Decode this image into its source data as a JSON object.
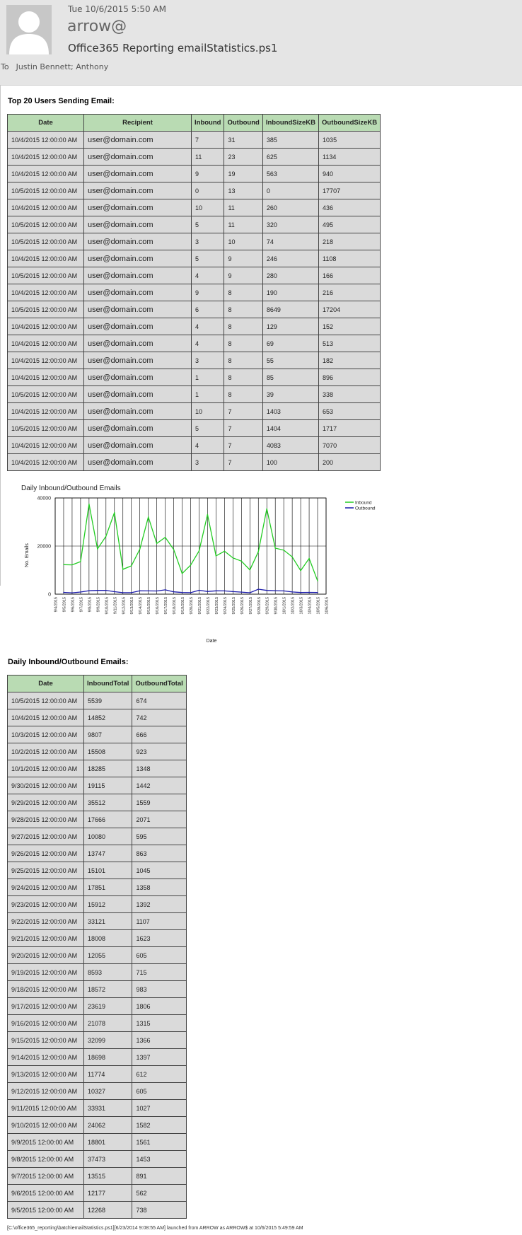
{
  "header": {
    "date": "Tue 10/6/2015 5:50 AM",
    "from": "arrow@",
    "subject": "Office365 Reporting emailStatistics.ps1",
    "to_label": "To",
    "recipients": "Justin Bennett; Anthony"
  },
  "top_users": {
    "title": "Top 20 Users Sending Email:",
    "columns": [
      "Date",
      "Recipient",
      "Inbound",
      "Outbound",
      "InboundSizeKB",
      "OutboundSizeKB"
    ],
    "rows": [
      [
        "10/4/2015 12:00:00 AM",
        "user@domain.com",
        "7",
        "31",
        "385",
        "1035"
      ],
      [
        "10/4/2015 12:00:00 AM",
        "user@domain.com",
        "11",
        "23",
        "625",
        "1134"
      ],
      [
        "10/4/2015 12:00:00 AM",
        "user@domain.com",
        "9",
        "19",
        "563",
        "940"
      ],
      [
        "10/5/2015 12:00:00 AM",
        "user@domain.com",
        "0",
        "13",
        "0",
        "17707"
      ],
      [
        "10/4/2015 12:00:00 AM",
        "user@domain.com",
        "10",
        "11",
        "260",
        "436"
      ],
      [
        "10/5/2015 12:00:00 AM",
        "user@domain.com",
        "5",
        "11",
        "320",
        "495"
      ],
      [
        "10/5/2015 12:00:00 AM",
        "user@domain.com",
        "3",
        "10",
        "74",
        "218"
      ],
      [
        "10/4/2015 12:00:00 AM",
        "user@domain.com",
        "5",
        "9",
        "246",
        "1108"
      ],
      [
        "10/5/2015 12:00:00 AM",
        "user@domain.com",
        "4",
        "9",
        "280",
        "166"
      ],
      [
        "10/4/2015 12:00:00 AM",
        "user@domain.com",
        "9",
        "8",
        "190",
        "216"
      ],
      [
        "10/5/2015 12:00:00 AM",
        "user@domain.com",
        "6",
        "8",
        "8649",
        "17204"
      ],
      [
        "10/4/2015 12:00:00 AM",
        "user@domain.com",
        "4",
        "8",
        "129",
        "152"
      ],
      [
        "10/4/2015 12:00:00 AM",
        "user@domain.com",
        "4",
        "8",
        "69",
        "513"
      ],
      [
        "10/4/2015 12:00:00 AM",
        "user@domain.com",
        "3",
        "8",
        "55",
        "182"
      ],
      [
        "10/4/2015 12:00:00 AM",
        "user@domain.com",
        "1",
        "8",
        "85",
        "896"
      ],
      [
        "10/5/2015 12:00:00 AM",
        "user@domain.com",
        "1",
        "8",
        "39",
        "338"
      ],
      [
        "10/4/2015 12:00:00 AM",
        "user@domain.com",
        "10",
        "7",
        "1403",
        "653"
      ],
      [
        "10/5/2015 12:00:00 AM",
        "user@domain.com",
        "5",
        "7",
        "1404",
        "1717"
      ],
      [
        "10/4/2015 12:00:00 AM",
        "user@domain.com",
        "4",
        "7",
        "4083",
        "7070"
      ],
      [
        "10/4/2015 12:00:00 AM",
        "user@domain.com",
        "3",
        "7",
        "100",
        "200"
      ]
    ]
  },
  "chart_data": {
    "type": "line",
    "title": "Daily Inbound/Outbound Emails",
    "xlabel": "Date",
    "ylabel": "No. Emails",
    "ylim": [
      0,
      40000
    ],
    "yticks": [
      0,
      20000,
      40000
    ],
    "grid": true,
    "legend_position": "top-right",
    "x": [
      "9/4/2015",
      "9/5/2015",
      "9/6/2015",
      "9/7/2015",
      "9/8/2015",
      "9/9/2015",
      "9/10/2015",
      "9/11/2015",
      "9/12/2015",
      "9/13/2015",
      "9/14/2015",
      "9/15/2015",
      "9/16/2015",
      "9/17/2015",
      "9/18/2015",
      "9/19/2015",
      "9/20/2015",
      "9/21/2015",
      "9/22/2015",
      "9/23/2015",
      "9/24/2015",
      "9/25/2015",
      "9/26/2015",
      "9/27/2015",
      "9/28/2015",
      "9/29/2015",
      "9/30/2015",
      "10/1/2015",
      "10/2/2015",
      "10/3/2015",
      "10/4/2015",
      "10/5/2015",
      "10/6/2015"
    ],
    "series": [
      {
        "name": "Inbound",
        "color": "#22cc22",
        "values": [
          null,
          12268,
          12177,
          13515,
          37473,
          18801,
          24062,
          33931,
          10327,
          11774,
          18698,
          32099,
          21078,
          23619,
          18572,
          8593,
          12055,
          18008,
          33121,
          15912,
          17851,
          15101,
          13747,
          10080,
          17666,
          35512,
          19115,
          18285,
          15508,
          9807,
          14852,
          5539,
          null
        ]
      },
      {
        "name": "Outbound",
        "color": "#1a1aaa",
        "values": [
          null,
          738,
          562,
          891,
          1453,
          1561,
          1582,
          1027,
          605,
          612,
          1397,
          1366,
          1315,
          1806,
          983,
          715,
          605,
          1623,
          1107,
          1392,
          1358,
          1045,
          863,
          595,
          2071,
          1559,
          1442,
          1348,
          923,
          666,
          742,
          674,
          null
        ]
      }
    ]
  },
  "daily": {
    "title": "Daily Inbound/Outbound Emails:",
    "columns": [
      "Date",
      "InboundTotal",
      "OutboundTotal"
    ],
    "rows": [
      [
        "10/5/2015 12:00:00 AM",
        "5539",
        "674"
      ],
      [
        "10/4/2015 12:00:00 AM",
        "14852",
        "742"
      ],
      [
        "10/3/2015 12:00:00 AM",
        "9807",
        "666"
      ],
      [
        "10/2/2015 12:00:00 AM",
        "15508",
        "923"
      ],
      [
        "10/1/2015 12:00:00 AM",
        "18285",
        "1348"
      ],
      [
        "9/30/2015 12:00:00 AM",
        "19115",
        "1442"
      ],
      [
        "9/29/2015 12:00:00 AM",
        "35512",
        "1559"
      ],
      [
        "9/28/2015 12:00:00 AM",
        "17666",
        "2071"
      ],
      [
        "9/27/2015 12:00:00 AM",
        "10080",
        "595"
      ],
      [
        "9/26/2015 12:00:00 AM",
        "13747",
        "863"
      ],
      [
        "9/25/2015 12:00:00 AM",
        "15101",
        "1045"
      ],
      [
        "9/24/2015 12:00:00 AM",
        "17851",
        "1358"
      ],
      [
        "9/23/2015 12:00:00 AM",
        "15912",
        "1392"
      ],
      [
        "9/22/2015 12:00:00 AM",
        "33121",
        "1107"
      ],
      [
        "9/21/2015 12:00:00 AM",
        "18008",
        "1623"
      ],
      [
        "9/20/2015 12:00:00 AM",
        "12055",
        "605"
      ],
      [
        "9/19/2015 12:00:00 AM",
        "8593",
        "715"
      ],
      [
        "9/18/2015 12:00:00 AM",
        "18572",
        "983"
      ],
      [
        "9/17/2015 12:00:00 AM",
        "23619",
        "1806"
      ],
      [
        "9/16/2015 12:00:00 AM",
        "21078",
        "1315"
      ],
      [
        "9/15/2015 12:00:00 AM",
        "32099",
        "1366"
      ],
      [
        "9/14/2015 12:00:00 AM",
        "18698",
        "1397"
      ],
      [
        "9/13/2015 12:00:00 AM",
        "11774",
        "612"
      ],
      [
        "9/12/2015 12:00:00 AM",
        "10327",
        "605"
      ],
      [
        "9/11/2015 12:00:00 AM",
        "33931",
        "1027"
      ],
      [
        "9/10/2015 12:00:00 AM",
        "24062",
        "1582"
      ],
      [
        "9/9/2015 12:00:00 AM",
        "18801",
        "1561"
      ],
      [
        "9/8/2015 12:00:00 AM",
        "37473",
        "1453"
      ],
      [
        "9/7/2015 12:00:00 AM",
        "13515",
        "891"
      ],
      [
        "9/6/2015 12:00:00 AM",
        "12177",
        "562"
      ],
      [
        "9/5/2015 12:00:00 AM",
        "12268",
        "738"
      ]
    ]
  },
  "footer": "[C:\\office365_reporting\\batch\\emailStatistics.ps1][6/23/2014 9:08:55 AM] launched from ARROW as ARROW$ at 10/6/2015 5:49:59 AM"
}
